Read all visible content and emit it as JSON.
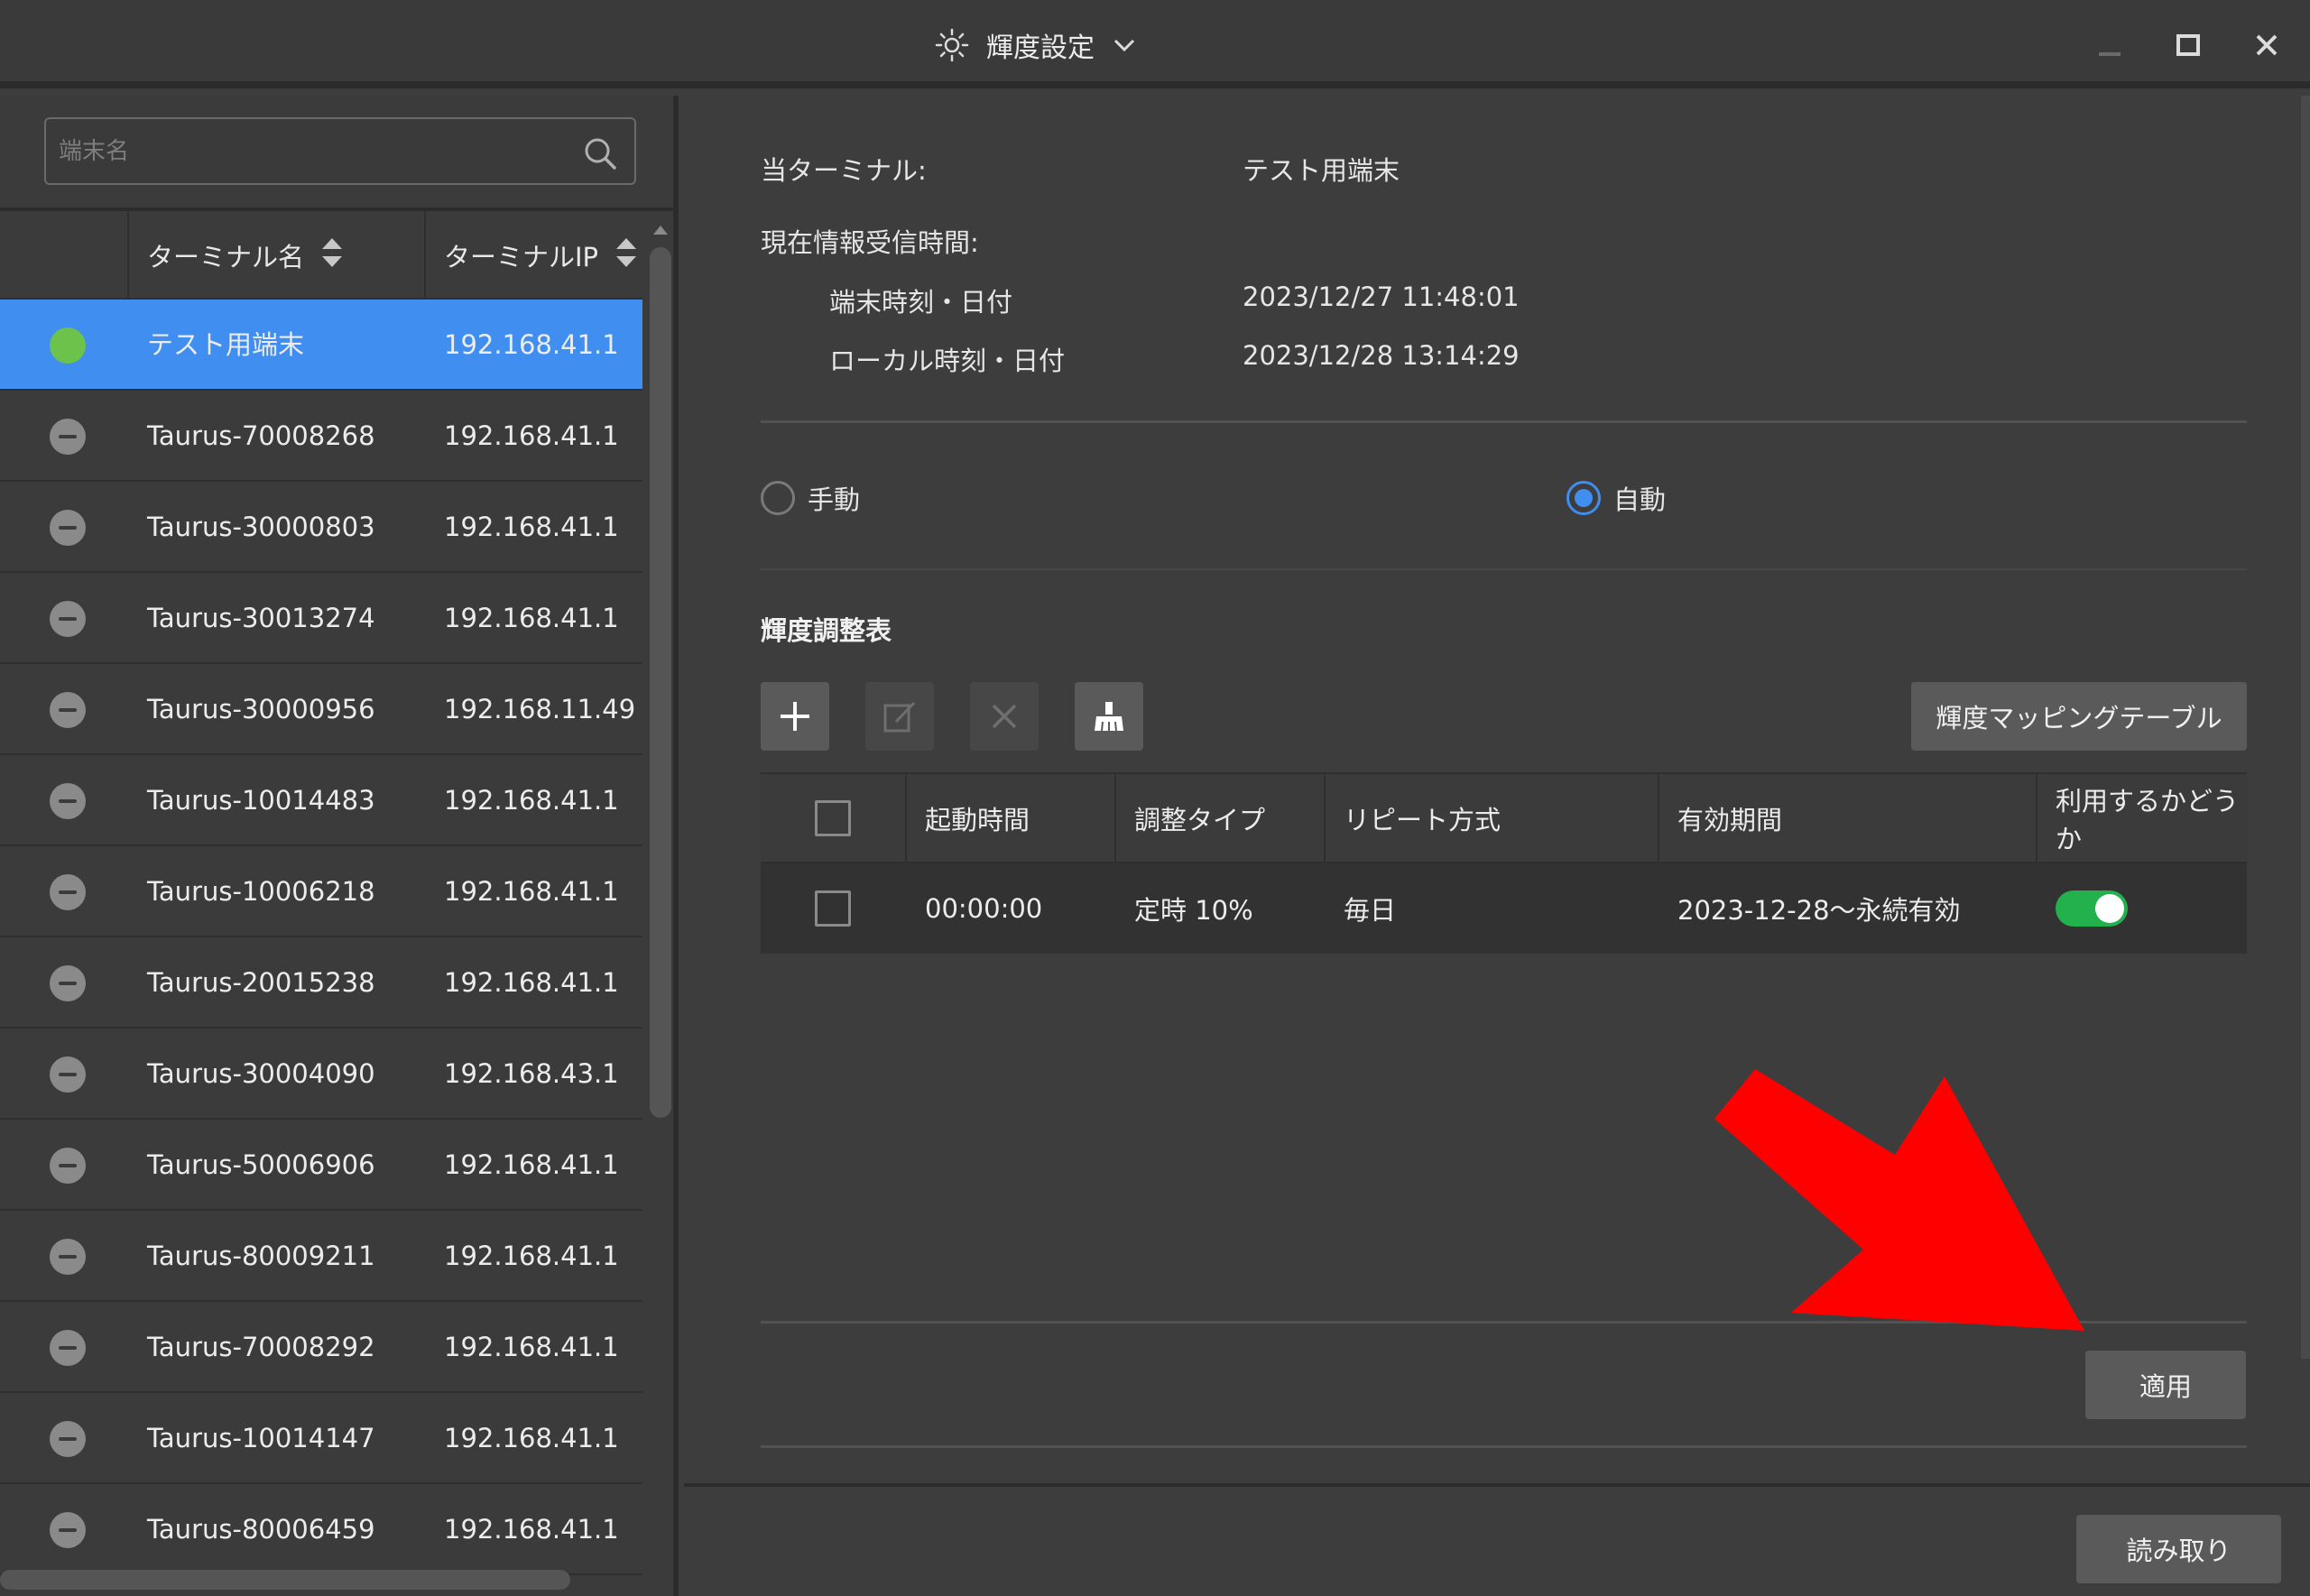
{
  "window": {
    "title": "輝度設定"
  },
  "search": {
    "placeholder": "端末名"
  },
  "terminal_list": {
    "columns": [
      "ターミナル名",
      "ターミナルIP"
    ],
    "rows": [
      {
        "name": "テスト用端末",
        "ip": "192.168.41.1",
        "status": "online",
        "selected": true
      },
      {
        "name": "Taurus-70008268",
        "ip": "192.168.41.1",
        "status": "offline"
      },
      {
        "name": "Taurus-30000803",
        "ip": "192.168.41.1",
        "status": "offline"
      },
      {
        "name": "Taurus-30013274",
        "ip": "192.168.41.1",
        "status": "offline"
      },
      {
        "name": "Taurus-30000956",
        "ip": "192.168.11.49",
        "status": "offline"
      },
      {
        "name": "Taurus-10014483",
        "ip": "192.168.41.1",
        "status": "offline"
      },
      {
        "name": "Taurus-10006218",
        "ip": "192.168.41.1",
        "status": "offline"
      },
      {
        "name": "Taurus-20015238",
        "ip": "192.168.41.1",
        "status": "offline"
      },
      {
        "name": "Taurus-30004090",
        "ip": "192.168.43.1",
        "status": "offline"
      },
      {
        "name": "Taurus-50006906",
        "ip": "192.168.41.1",
        "status": "offline"
      },
      {
        "name": "Taurus-80009211",
        "ip": "192.168.41.1",
        "status": "offline"
      },
      {
        "name": "Taurus-70008292",
        "ip": "192.168.41.1",
        "status": "offline"
      },
      {
        "name": "Taurus-10014147",
        "ip": "192.168.41.1",
        "status": "offline"
      },
      {
        "name": "Taurus-80006459",
        "ip": "192.168.41.1",
        "status": "offline"
      }
    ]
  },
  "info": {
    "current_terminal_label": "当ターミナル:",
    "current_terminal_value": "テスト用端末",
    "received_time_label": "現在情報受信時間:",
    "terminal_time_label": "端末時刻・日付",
    "terminal_time_value": "2023/12/27 11:48:01",
    "local_time_label": "ローカル時刻・日付",
    "local_time_value": "2023/12/28 13:14:29"
  },
  "mode": {
    "manual_label": "手動",
    "auto_label": "自動",
    "selected": "auto"
  },
  "schedule": {
    "title": "輝度調整表",
    "mapping_button": "輝度マッピングテーブル",
    "columns": [
      "起動時間",
      "調整タイプ",
      "リピート方式",
      "有効期間",
      "利用するかどうか"
    ],
    "rows": [
      {
        "start": "00:00:00",
        "type": "定時 10%",
        "repeat": "毎日",
        "period": "2023-12-28～永続有効",
        "enabled": true
      }
    ]
  },
  "buttons": {
    "apply": "適用",
    "read": "読み取り"
  },
  "colors": {
    "accent": "#3f8ef0",
    "online": "#6cc24a",
    "toggle_on": "#22b14c",
    "annotation_arrow": "#ff0000"
  }
}
